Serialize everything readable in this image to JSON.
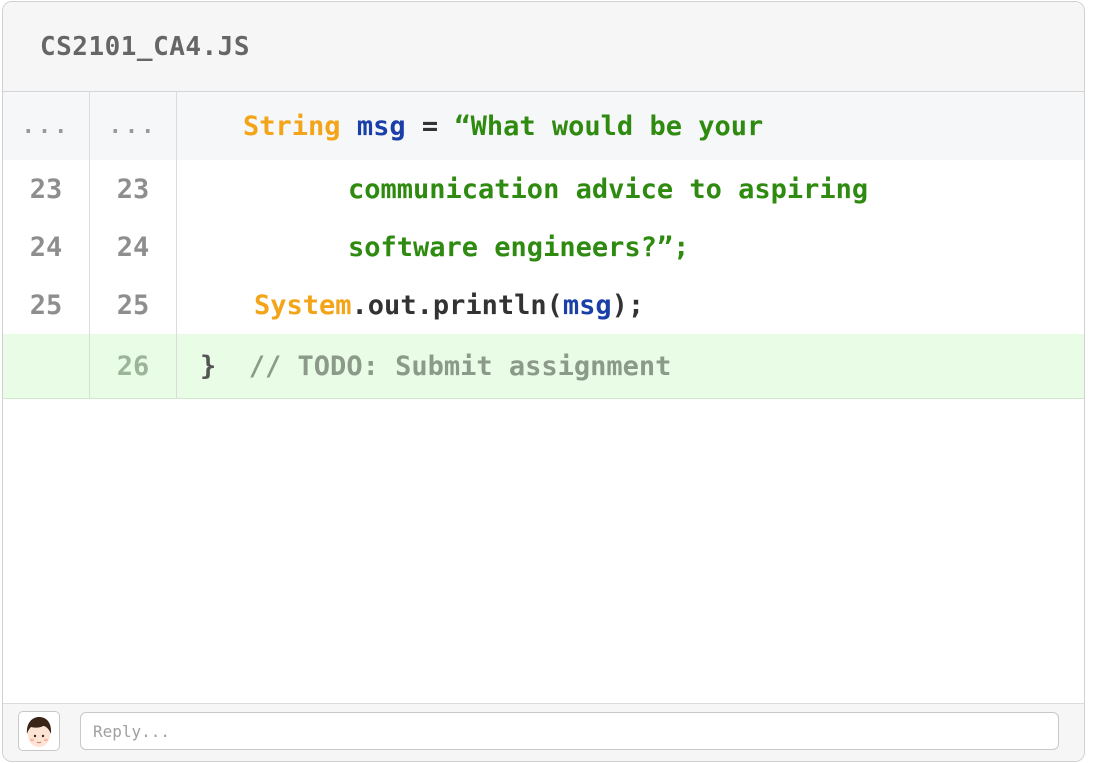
{
  "file": {
    "name": "CS2101_CA4.JS"
  },
  "diff": {
    "hunk": {
      "old": "...",
      "new": "...",
      "tokens": {
        "type": "String",
        "name": "msg",
        "eq": " = ",
        "str": "“What would be your"
      }
    },
    "rows": [
      {
        "old": "23",
        "new": "23",
        "text": "communication advice to aspiring"
      },
      {
        "old": "24",
        "new": "24",
        "text": "software engineers?”;"
      }
    ],
    "print_row": {
      "old": "25",
      "new": "25",
      "obj": "System",
      "call": ".out.println(",
      "arg": "msg",
      "end": ");"
    },
    "added_row": {
      "old": "",
      "new": "26",
      "brace": "}",
      "comment": "// TODO: Submit assignment"
    }
  },
  "reply": {
    "placeholder": "Reply..."
  },
  "colors": {
    "keyword": "#f4a418",
    "variable": "#1a3fa8",
    "string": "#2f8a10",
    "comment": "#8c9a8a",
    "added_bg": "#e8fce6"
  }
}
